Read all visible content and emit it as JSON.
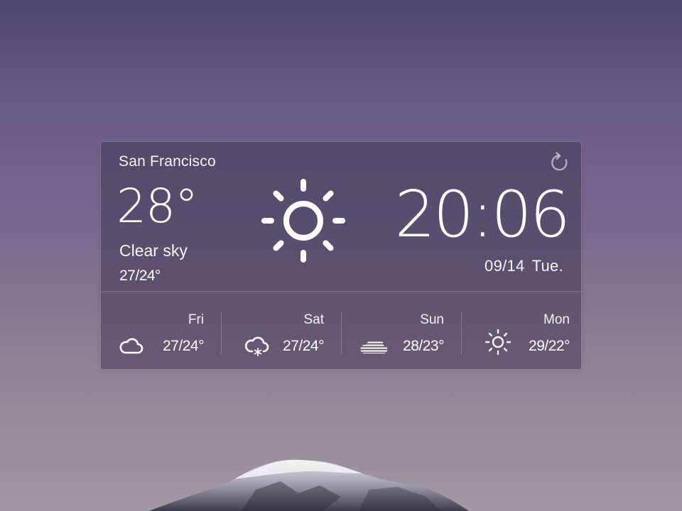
{
  "widget": {
    "city": "San Francisco",
    "temperature": "28°",
    "condition": "Clear sky",
    "range": "27/24°",
    "time": "20:06",
    "date": "09/14",
    "weekday": "Tue.",
    "icons": {
      "current": "sun-icon",
      "refresh": "refresh-icon"
    }
  },
  "forecast": [
    {
      "day": "Fri",
      "range": "27/24°",
      "icon": "cloud-icon"
    },
    {
      "day": "Sat",
      "range": "27/24°",
      "icon": "cloud-snow-icon"
    },
    {
      "day": "Sun",
      "range": "28/23°",
      "icon": "fog-icon"
    },
    {
      "day": "Mon",
      "range": "29/22°",
      "icon": "sun-icon"
    }
  ]
}
